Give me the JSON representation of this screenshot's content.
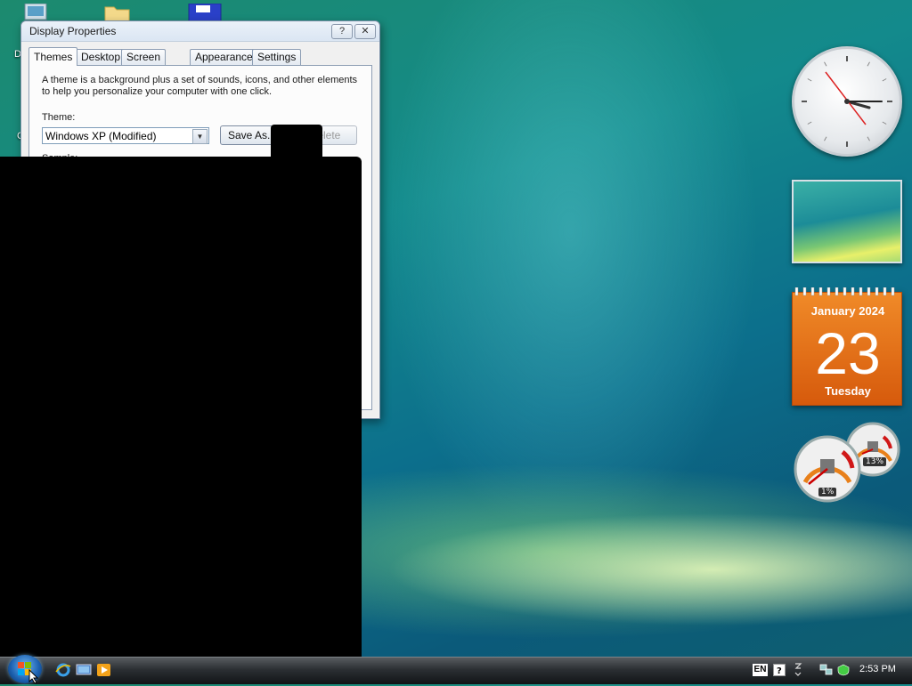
{
  "window": {
    "title": "Display Properties",
    "help_glyph": "?",
    "close_glyph": "✕",
    "tabs": [
      {
        "label": "Themes"
      },
      {
        "label": "Desktop"
      },
      {
        "label": "Screen Saver"
      },
      {
        "label": "Appearance"
      },
      {
        "label": "Settings"
      }
    ],
    "themes": {
      "description": "A theme is a background plus a set of sounds, icons, and other elements to help you personalize your computer with one click.",
      "theme_label": "Theme:",
      "theme_value": "Windows XP (Modified)",
      "save_as_label": "Save As...",
      "delete_label": "Delete",
      "sample_label": "Sample:"
    }
  },
  "desktop": {
    "icon_labels": [
      "D",
      "C"
    ]
  },
  "gadgets": {
    "calendar": {
      "month": "January 2024",
      "day": "23",
      "weekday": "Tuesday"
    },
    "cpu_meter": {
      "cpu_percent": "1%",
      "memory_percent": "13%"
    }
  },
  "taskbar": {
    "language": "EN",
    "time": "2:53 PM"
  },
  "colors": {
    "calendar_orange": "#e56e1a",
    "taskbar_dark": "#1f2326"
  }
}
